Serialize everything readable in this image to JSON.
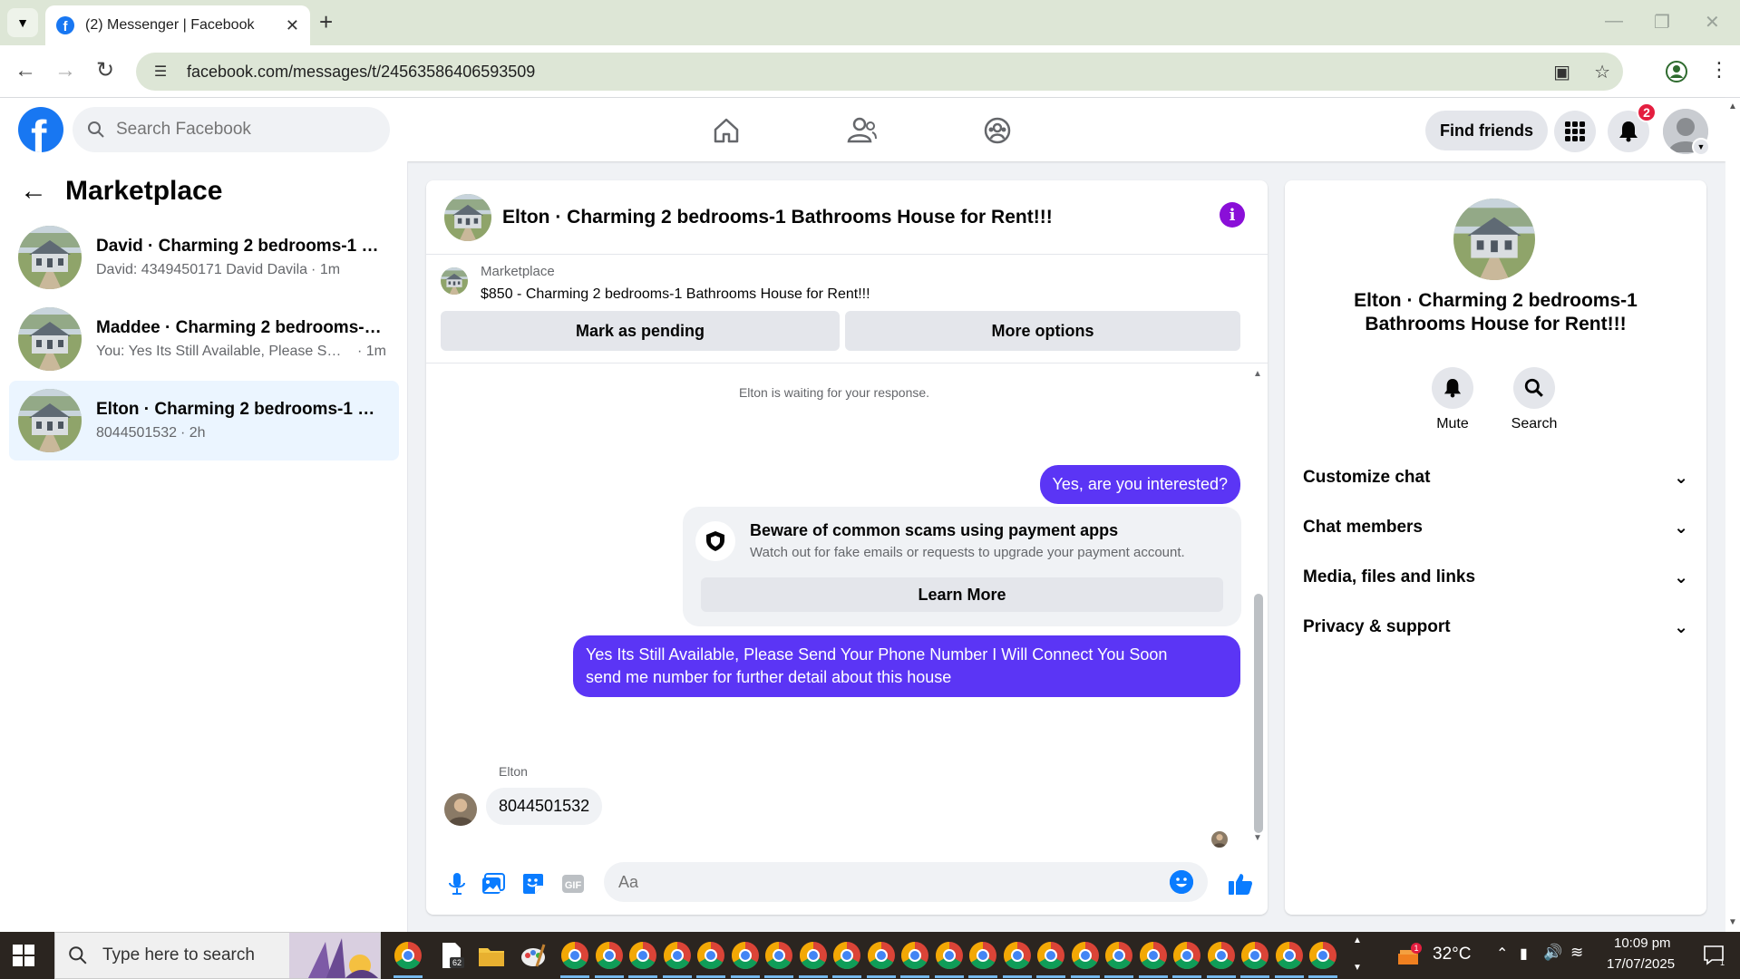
{
  "browser": {
    "tab_title": "(2) Messenger | Facebook",
    "url": "facebook.com/messages/t/24563586406593509"
  },
  "fb_nav": {
    "search_placeholder": "Search Facebook",
    "find_friends": "Find friends",
    "notification_count": "2",
    "brand_color": "#1877f2"
  },
  "left_panel": {
    "title": "Marketplace",
    "conversations": [
      {
        "name": "David · Charming 2 bedrooms-1 B...",
        "preview": "David: 4349450171 David Davila",
        "time": "· 1m"
      },
      {
        "name": "Maddee · Charming 2 bedrooms-1...",
        "preview": "You: Yes Its Still Available, Please Sen...",
        "time": "· 1m"
      },
      {
        "name": "Elton · Charming 2 bedrooms-1 Ba...",
        "preview": "8044501532",
        "time": "· 2h"
      }
    ]
  },
  "chat": {
    "header_name": "Elton · Charming 2 bedrooms-1 Bathrooms House for Rent!!!",
    "listing_label": "Marketplace",
    "listing_price": "$850 - Charming 2 bedrooms-1 Bathrooms House for Rent!!!",
    "mark_pending": "Mark as pending",
    "more_options": "More options",
    "waiting_text": "Elton is waiting for your response.",
    "msg_interested": "Yes, are you interested?",
    "scam_title": "Beware of common scams using payment apps",
    "scam_desc": "Watch out for fake emails or requests to upgrade your payment account.",
    "learn_more": "Learn More",
    "msg_available_line1": "Yes Its Still Available, Please Send Your Phone Number I Will Connect You Soon",
    "msg_available_line2": "send me number for further detail about this house",
    "sender_name": "Elton",
    "incoming_msg": "8044501532",
    "input_placeholder": "Aa",
    "accent_color": "#5b35f5"
  },
  "right_panel": {
    "name": "Elton · Charming 2 bedrooms-1 Bathrooms House for Rent!!!",
    "mute_label": "Mute",
    "search_label": "Search",
    "rows": [
      "Customize chat",
      "Chat members",
      "Media, files and links",
      "Privacy & support"
    ]
  },
  "taskbar": {
    "search_placeholder": "Type here to search",
    "temperature": "32°C",
    "time": "10:09 pm",
    "date": "17/07/2025",
    "notification_badge": "1",
    "app_badge": "62"
  }
}
